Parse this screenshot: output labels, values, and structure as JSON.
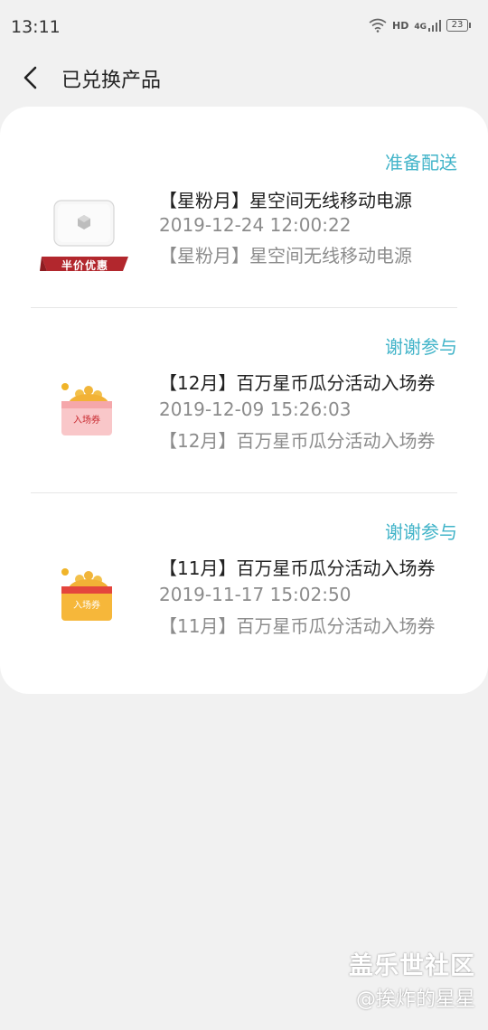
{
  "status_bar": {
    "time": "13:11",
    "network_hd": "HD",
    "network_gen": "4G",
    "battery": "23"
  },
  "header": {
    "title": "已兑换产品"
  },
  "items": [
    {
      "status": "准备配送",
      "title": "【星粉月】星空间无线移动电源",
      "time": "2019-12-24 12:00:22",
      "desc": "【星粉月】星空间无线移动电源",
      "thumb_badge": "半价优惠"
    },
    {
      "status": "谢谢参与",
      "title": "【12月】百万星币瓜分活动入场券",
      "time": "2019-12-09 15:26:03",
      "desc": "【12月】百万星币瓜分活动入场券",
      "thumb_badge": "入场券"
    },
    {
      "status": "谢谢参与",
      "title": "【11月】百万星币瓜分活动入场券",
      "time": "2019-11-17 15:02:50",
      "desc": "【11月】百万星币瓜分活动入场券",
      "thumb_badge": "入场券"
    }
  ],
  "watermark": {
    "brand": "盖乐世社区",
    "author": "@挨炸的星星"
  },
  "colors": {
    "accent": "#42b4c9",
    "background": "#f1f1f1",
    "card": "#ffffff"
  }
}
